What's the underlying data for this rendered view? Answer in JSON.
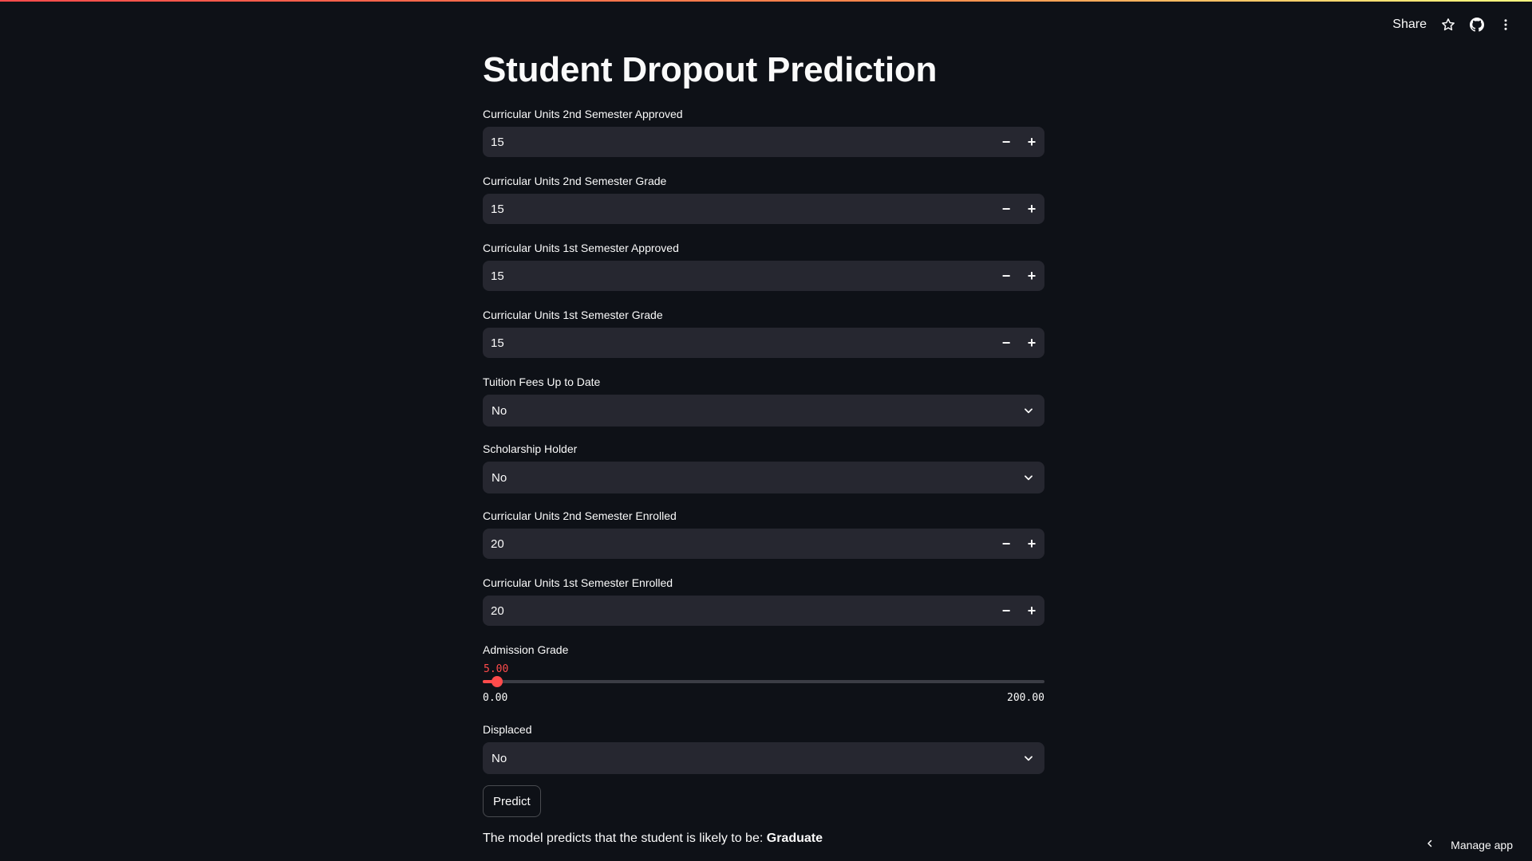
{
  "header": {
    "share_label": "Share",
    "icons": [
      "star-icon",
      "github-icon",
      "more-vertical-icon"
    ]
  },
  "page": {
    "title": "Student Dropout Prediction"
  },
  "fields": {
    "cu2_approved": {
      "label": "Curricular Units 2nd Semester Approved",
      "value": "15"
    },
    "cu2_grade": {
      "label": "Curricular Units 2nd Semester Grade",
      "value": "15"
    },
    "cu1_approved": {
      "label": "Curricular Units 1st Semester Approved",
      "value": "15"
    },
    "cu1_grade": {
      "label": "Curricular Units 1st Semester Grade",
      "value": "15"
    },
    "tuition": {
      "label": "Tuition Fees Up to Date",
      "value": "No"
    },
    "scholarship": {
      "label": "Scholarship Holder",
      "value": "No"
    },
    "cu2_enrolled": {
      "label": "Curricular Units 2nd Semester Enrolled",
      "value": "20"
    },
    "cu1_enrolled": {
      "label": "Curricular Units 1st Semester Enrolled",
      "value": "20"
    },
    "admission": {
      "label": "Admission Grade",
      "value": "5.00",
      "min": "0.00",
      "max": "200.00",
      "fraction": 0.025
    },
    "displaced": {
      "label": "Displaced",
      "value": "No"
    }
  },
  "stepper": {
    "minus": "−",
    "plus": "+"
  },
  "predict_button": "Predict",
  "result": {
    "prefix": "The model predicts that the student is likely to be:",
    "value": "Graduate"
  },
  "footer": {
    "manage_app": "Manage app"
  },
  "colors": {
    "accent": "#ff4b4b",
    "background": "#0e1117",
    "input_bg": "#262730"
  }
}
